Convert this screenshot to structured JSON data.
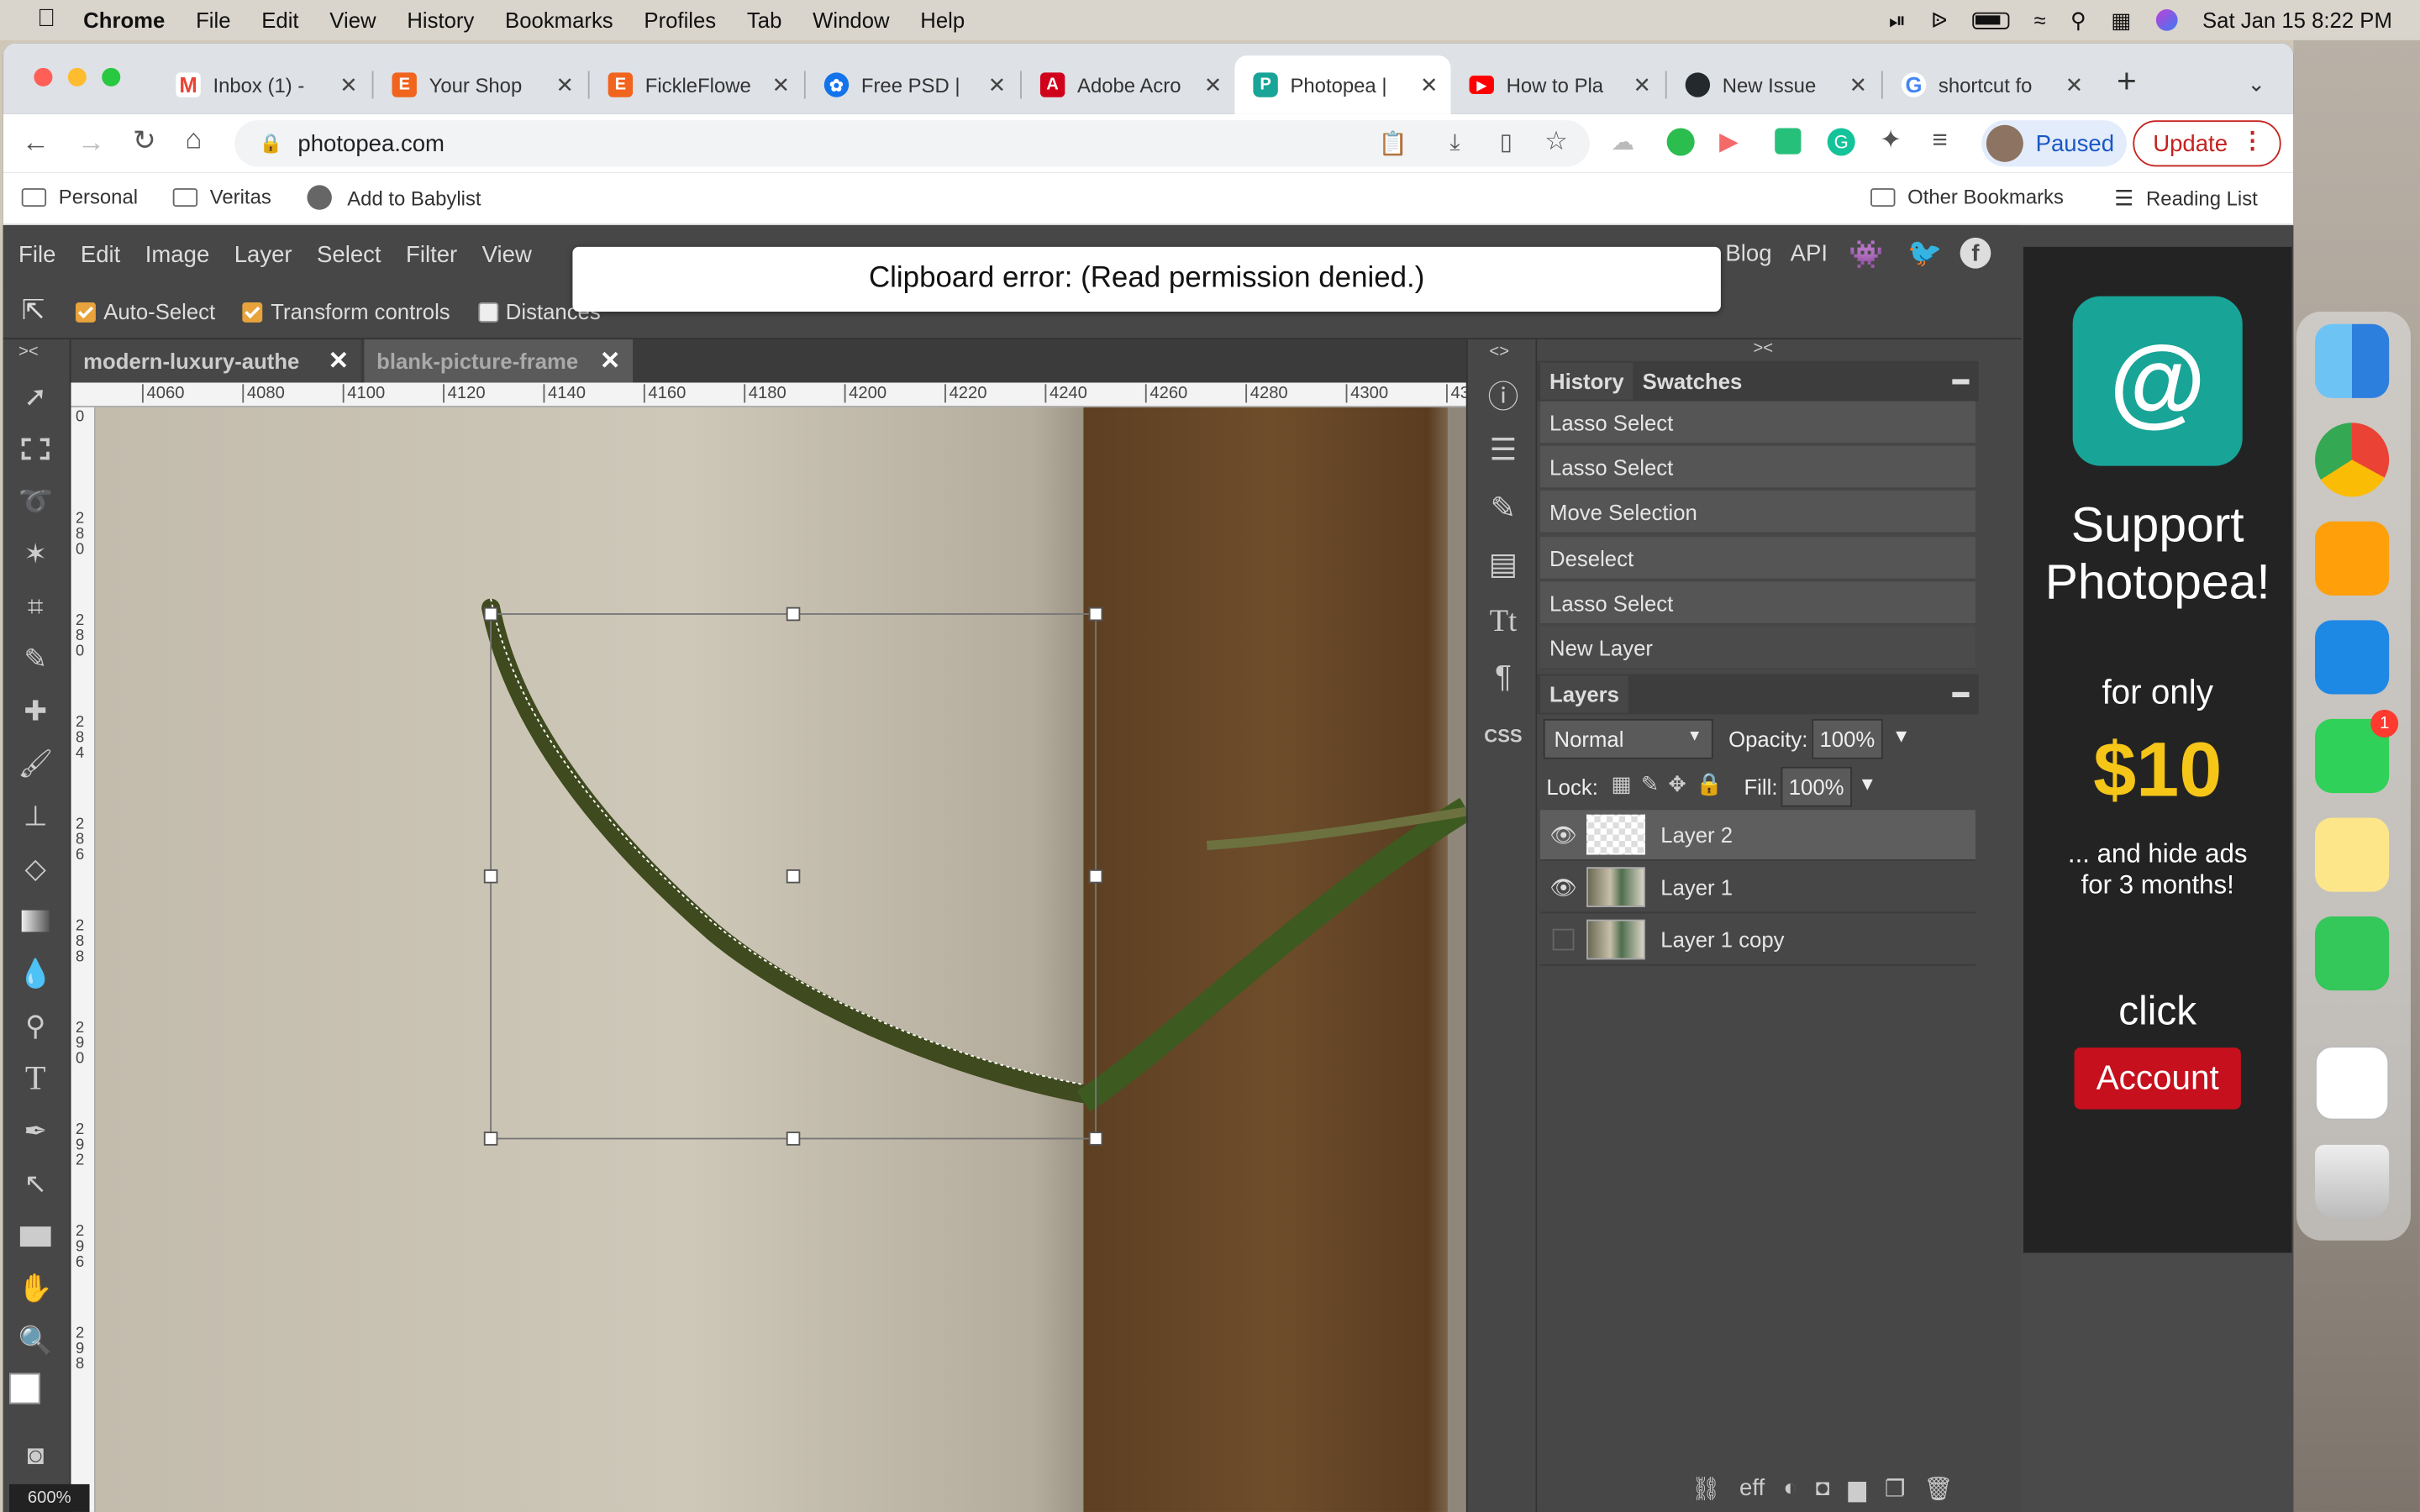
{
  "menubar": {
    "app": "Chrome",
    "items": [
      "File",
      "Edit",
      "View",
      "History",
      "Bookmarks",
      "Profiles",
      "Tab",
      "Window",
      "Help"
    ],
    "clock": "Sat Jan 15  8:22 PM"
  },
  "tabs": [
    {
      "label": "Inbox (1) -",
      "icon": "gmail-icon",
      "color": "#ea4335"
    },
    {
      "label": "Your Shop",
      "icon": "etsy-icon",
      "color": "#f1641e"
    },
    {
      "label": "FickleFlowe",
      "icon": "etsy-icon",
      "color": "#f1641e"
    },
    {
      "label": "Free PSD |",
      "icon": "freepik-icon",
      "color": "#1273eb"
    },
    {
      "label": "Adobe Acro",
      "icon": "acrobat-icon",
      "color": "#d0021b"
    },
    {
      "label": "Photopea |",
      "icon": "photopea-icon",
      "color": "#18a497"
    },
    {
      "label": "How to Pla",
      "icon": "youtube-icon",
      "color": "#ff0000"
    },
    {
      "label": "New Issue",
      "icon": "github-icon",
      "color": "#24292e"
    },
    {
      "label": "shortcut fo",
      "icon": "google-icon",
      "color": "#4285f4"
    }
  ],
  "address": {
    "url": "photopea.com"
  },
  "profile": {
    "label": "Paused"
  },
  "update": {
    "label": "Update"
  },
  "bookmarks": {
    "items": [
      "Personal",
      "Veritas",
      "Add to Babylist"
    ],
    "other": "Other Bookmarks",
    "reading": "Reading List"
  },
  "photopea": {
    "menu": [
      "File",
      "Edit",
      "Image",
      "Layer",
      "Select",
      "Filter",
      "View"
    ],
    "menu_right": [
      "Blog",
      "API"
    ],
    "options": {
      "auto_select": "Auto-Select",
      "transform": "Transform controls",
      "distances": "Distances"
    },
    "clipboard_error": "Clipboard error: (Read permission denied.)",
    "doc_tabs": [
      "modern-luxury-authe",
      "blank-picture-frame"
    ],
    "ruler_ticks": [
      "4060",
      "4080",
      "4100",
      "4120",
      "4140",
      "4160",
      "4180",
      "4200",
      "4220",
      "4240",
      "4260",
      "4280",
      "4300",
      "43"
    ],
    "ruler_v_ticks": [
      "0",
      "280",
      "280",
      "284",
      "286",
      "288",
      "290",
      "292",
      "296",
      "298"
    ],
    "zoom": "600%",
    "history": {
      "tab1": "History",
      "tab2": "Swatches",
      "items": [
        "Lasso Select",
        "Lasso Select",
        "Move Selection",
        "Deselect",
        "Lasso Select",
        "New Layer"
      ]
    },
    "layers": {
      "title": "Layers",
      "blend": "Normal",
      "opacity_label": "Opacity:",
      "opacity": "100%",
      "lock_label": "Lock:",
      "fill_label": "Fill:",
      "fill": "100%",
      "items": [
        {
          "name": "Layer 2",
          "visible": true,
          "selected": true
        },
        {
          "name": "Layer 1",
          "visible": true,
          "selected": false
        },
        {
          "name": "Layer 1 copy",
          "visible": false,
          "selected": false
        }
      ]
    },
    "ad": {
      "line1": "Support",
      "line2": "Photopea!",
      "line3": "for only",
      "price": "$10",
      "line4": "... and hide ads",
      "line5": "for 3 months!",
      "click": "click",
      "button": "Account"
    }
  },
  "dock": {
    "badge": "1"
  }
}
